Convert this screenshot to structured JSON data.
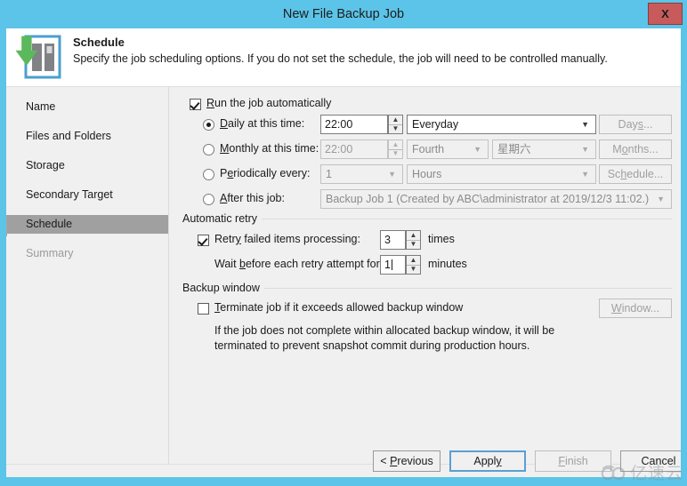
{
  "window": {
    "title": "New File Backup Job",
    "close_label": "X",
    "accent_color": "#5bc4e8",
    "close_color": "#c75b5b"
  },
  "header": {
    "icon": "backup-download-server-icon",
    "title": "Schedule",
    "subtitle": "Specify the job scheduling options. If you do not set the schedule, the job will need to be controlled manually."
  },
  "sidebar": {
    "items": [
      {
        "label": "Name",
        "state": "normal"
      },
      {
        "label": "Files and Folders",
        "state": "normal"
      },
      {
        "label": "Storage",
        "state": "normal"
      },
      {
        "label": "Secondary Target",
        "state": "normal"
      },
      {
        "label": "Schedule",
        "state": "selected"
      },
      {
        "label": "Summary",
        "state": "disabled"
      }
    ]
  },
  "schedule": {
    "run_automatically": {
      "label_pre": "R",
      "label_acc": "u",
      "label_post": "n the job automatically",
      "checked": true
    },
    "options": [
      {
        "id": "daily",
        "selected": true,
        "label_pre": "",
        "label_acc": "D",
        "label_post": "aily at this time:",
        "time_value": "22:00",
        "combo1": "Everyday",
        "combo2": null,
        "button": "Days...",
        "button_acc_index": 3,
        "enabled": true
      },
      {
        "id": "monthly",
        "selected": false,
        "label_pre": "",
        "label_acc": "M",
        "label_post": "onthly at this time:",
        "time_value": "22:00",
        "combo1": "Fourth",
        "combo2": "星期六",
        "button": "Months...",
        "button_acc_index": 2,
        "enabled": false
      },
      {
        "id": "periodically",
        "selected": false,
        "label_pre": "P",
        "label_acc": "e",
        "label_post": "riodically every:",
        "time_value": "1",
        "combo1": "Hours",
        "combo2": null,
        "button": "Schedule...",
        "button_acc_index": 3,
        "enabled": false
      },
      {
        "id": "after_job",
        "selected": false,
        "label_pre": "",
        "label_acc": "A",
        "label_post": "fter this job:",
        "time_value": null,
        "combo1": "Backup Job 1 (Created by ABC\\administrator at 2019/12/3 11:02.)",
        "combo2": null,
        "button": null,
        "enabled": false
      }
    ]
  },
  "automatic_retry": {
    "group_label": "Automatic retry",
    "retry_checkbox": {
      "label_pre": "Retr",
      "label_acc": "y",
      "label_post": " failed items processing:",
      "checked": true
    },
    "retry_times_value": "3",
    "retry_times_unit": "times",
    "wait_label_pre": "Wait ",
    "wait_label_acc": "b",
    "wait_label_post": "efore each retry attempt for:",
    "wait_value": "1",
    "wait_unit": "minutes"
  },
  "backup_window": {
    "group_label": "Backup window",
    "terminate_checkbox": {
      "label_pre": "",
      "label_acc": "T",
      "label_post": "erminate job if it exceeds allowed backup window",
      "checked": false
    },
    "window_button": "Window...",
    "window_button_acc_index": 1,
    "description": "If the job does not complete within allocated backup window, it will be\nterminated to prevent snapshot commit during production hours."
  },
  "footer": {
    "buttons": [
      {
        "id": "previous",
        "label_pre": "< ",
        "label_acc": "P",
        "label_post": "revious",
        "enabled": true,
        "focused": false
      },
      {
        "id": "apply",
        "label_pre": "Appl",
        "label_acc": "y",
        "label_post": "",
        "enabled": true,
        "focused": true
      },
      {
        "id": "finish",
        "label_pre": "",
        "label_acc": "F",
        "label_post": "inish",
        "enabled": false,
        "focused": false
      },
      {
        "id": "cancel",
        "label_pre": "Cancel",
        "label_acc": "",
        "label_post": "",
        "enabled": true,
        "focused": false
      }
    ]
  },
  "watermark": {
    "text": "亿速云",
    "logo": "cloud-infinity-logo"
  }
}
